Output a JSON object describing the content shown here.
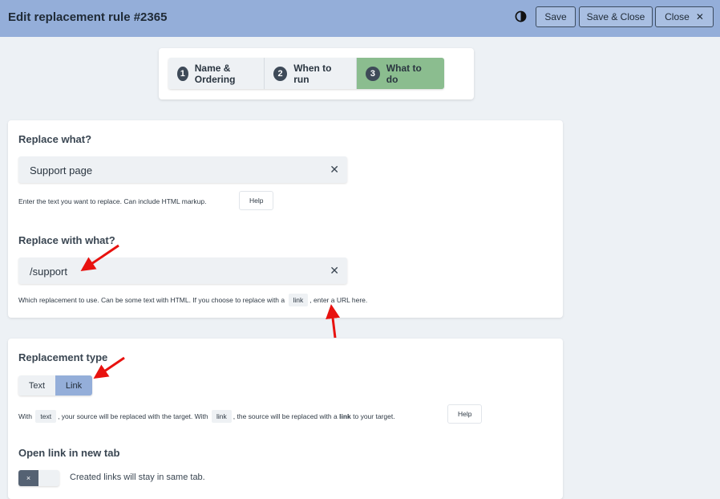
{
  "header": {
    "title": "Edit replacement rule #2365",
    "contrast_icon": "contrast-icon",
    "save_label": "Save",
    "save_close_label": "Save & Close",
    "close_label": "Close",
    "close_icon": "close-icon"
  },
  "stepper": {
    "steps": [
      {
        "num": "1",
        "label": "Name & Ordering"
      },
      {
        "num": "2",
        "label": "When to run"
      },
      {
        "num": "3",
        "label": "What to do"
      }
    ],
    "active_color": "#8bbd8f"
  },
  "replace_what": {
    "title": "Replace what?",
    "value": "Support page",
    "hint": "Enter the text you want to replace. Can include HTML markup.",
    "help_label": "Help"
  },
  "replace_with": {
    "title": "Replace with what?",
    "value": "/support",
    "hint_before": "Which replacement to use. Can be some text with HTML. If you choose to replace with a",
    "hint_chip": "link",
    "hint_after": ", enter a URL here."
  },
  "replacement_type": {
    "title": "Replacement type",
    "options": [
      "Text",
      "Link"
    ],
    "selected": "Link",
    "hint_1": "With",
    "chip_text": "text",
    "hint_2": ", your source will be replaced with the target. With",
    "chip_link": "link",
    "hint_3": ", the source will be replaced with a",
    "hint_bold": "link",
    "hint_4": "to your target.",
    "help_label": "Help"
  },
  "open_new_tab": {
    "title": "Open link in new tab",
    "toggle_symbol": "×",
    "label": "Created links will stay in same tab."
  },
  "colors": {
    "header_bg": "#94aed9",
    "page_bg": "#edf1f5",
    "annotation_arrow": "#e8120f"
  }
}
